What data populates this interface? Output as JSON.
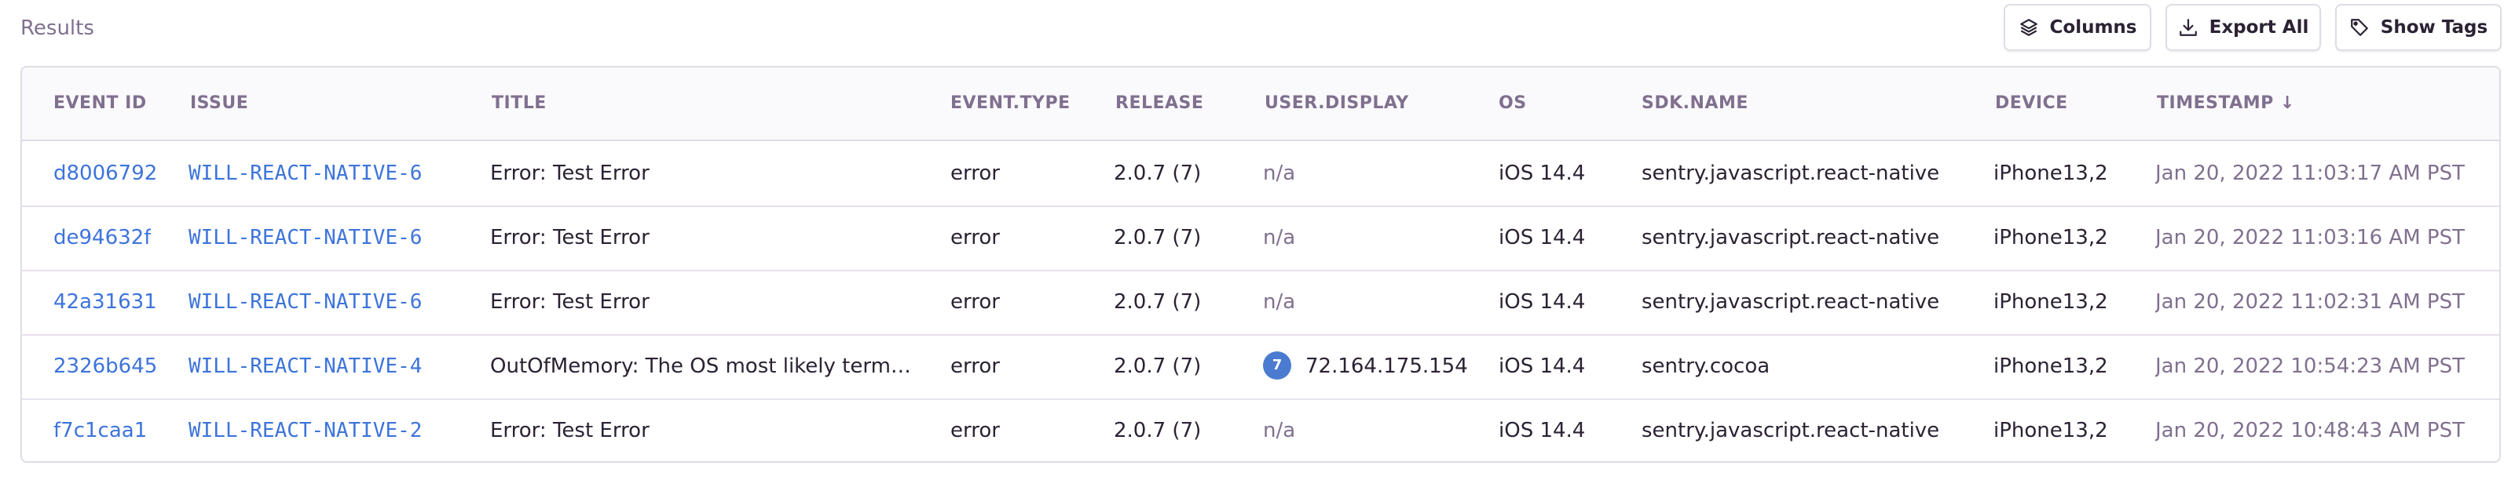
{
  "header": {
    "title": "Results",
    "buttons": {
      "columns": "Columns",
      "export": "Export All",
      "tags": "Show Tags"
    }
  },
  "table": {
    "columns": [
      "EVENT ID",
      "ISSUE",
      "TITLE",
      "EVENT.TYPE",
      "RELEASE",
      "USER.DISPLAY",
      "OS",
      "SDK.NAME",
      "DEVICE",
      "TIMESTAMP"
    ],
    "sort_indicator": "↓",
    "rows": [
      {
        "event_id": "d8006792",
        "issue": "WILL-REACT-NATIVE-6",
        "title": "Error: Test Error",
        "event_type": "error",
        "release": "2.0.7 (7)",
        "user_display": "n/a",
        "user_avatar": "",
        "os": "iOS 14.4",
        "sdk": "sentry.javascript.react-native",
        "device": "iPhone13,2",
        "timestamp": "Jan 20, 2022 11:03:17 AM PST"
      },
      {
        "event_id": "de94632f",
        "issue": "WILL-REACT-NATIVE-6",
        "title": "Error: Test Error",
        "event_type": "error",
        "release": "2.0.7 (7)",
        "user_display": "n/a",
        "user_avatar": "",
        "os": "iOS 14.4",
        "sdk": "sentry.javascript.react-native",
        "device": "iPhone13,2",
        "timestamp": "Jan 20, 2022 11:03:16 AM PST"
      },
      {
        "event_id": "42a31631",
        "issue": "WILL-REACT-NATIVE-6",
        "title": "Error: Test Error",
        "event_type": "error",
        "release": "2.0.7 (7)",
        "user_display": "n/a",
        "user_avatar": "",
        "os": "iOS 14.4",
        "sdk": "sentry.javascript.react-native",
        "device": "iPhone13,2",
        "timestamp": "Jan 20, 2022 11:02:31 AM PST"
      },
      {
        "event_id": "2326b645",
        "issue": "WILL-REACT-NATIVE-4",
        "title": "OutOfMemory: The OS most likely term…",
        "event_type": "error",
        "release": "2.0.7 (7)",
        "user_display": "72.164.175.154",
        "user_avatar": "7",
        "os": "iOS 14.4",
        "sdk": "sentry.cocoa",
        "device": "iPhone13,2",
        "timestamp": "Jan 20, 2022 10:54:23 AM PST"
      },
      {
        "event_id": "f7c1caa1",
        "issue": "WILL-REACT-NATIVE-2",
        "title": "Error: Test Error",
        "event_type": "error",
        "release": "2.0.7 (7)",
        "user_display": "n/a",
        "user_avatar": "",
        "os": "iOS 14.4",
        "sdk": "sentry.javascript.react-native",
        "device": "iPhone13,2",
        "timestamp": "Jan 20, 2022 10:48:43 AM PST"
      }
    ]
  },
  "icons": {
    "columns": "layers-icon",
    "export": "download-icon",
    "tags": "tag-icon"
  },
  "colors": {
    "link": "#3d74db",
    "muted": "#80708f",
    "avatar": "#4a7bd0",
    "border": "#e0dce5"
  }
}
